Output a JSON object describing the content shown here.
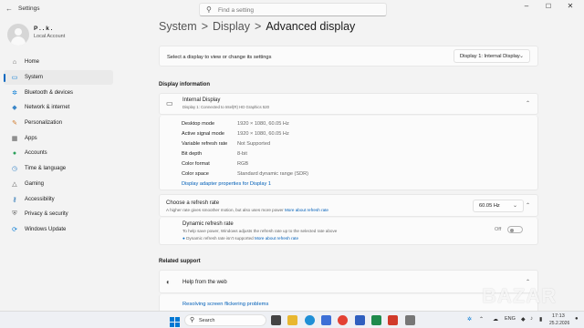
{
  "window": {
    "title": "Settings",
    "search_placeholder": "Find a setting"
  },
  "account": {
    "name": "P . . k .",
    "type": "Local Account"
  },
  "sidebar": {
    "items": [
      {
        "label": "Home",
        "icon": "home-icon"
      },
      {
        "label": "System",
        "icon": "system-icon",
        "active": true
      },
      {
        "label": "Bluetooth & devices",
        "icon": "bluetooth-icon"
      },
      {
        "label": "Network & internet",
        "icon": "wifi-icon"
      },
      {
        "label": "Personalization",
        "icon": "brush-icon"
      },
      {
        "label": "Apps",
        "icon": "apps-icon"
      },
      {
        "label": "Accounts",
        "icon": "person-icon"
      },
      {
        "label": "Time & language",
        "icon": "clock-icon"
      },
      {
        "label": "Gaming",
        "icon": "gamepad-icon"
      },
      {
        "label": "Accessibility",
        "icon": "accessibility-icon"
      },
      {
        "label": "Privacy & security",
        "icon": "shield-icon"
      },
      {
        "label": "Windows Update",
        "icon": "update-icon"
      }
    ]
  },
  "breadcrumb": {
    "first": "System",
    "second": "Display",
    "current": "Advanced display",
    "separator": ">"
  },
  "display_select": {
    "label": "Select a display to view or change its settings",
    "value": "Display 1: Internal Display"
  },
  "display_info": {
    "heading": "Display information",
    "name": "Internal Display",
    "subtitle": "Display 1: Connected to Intel(R) HD Graphics 520",
    "rows": [
      {
        "label": "Desktop mode",
        "value": "1920 × 1080, 60.05 Hz"
      },
      {
        "label": "Active signal mode",
        "value": "1920 × 1080, 60.05 Hz"
      },
      {
        "label": "Variable refresh rate",
        "value": "Not Supported"
      },
      {
        "label": "Bit depth",
        "value": "8-bit"
      },
      {
        "label": "Color format",
        "value": "RGB"
      },
      {
        "label": "Color space",
        "value": "Standard dynamic range (SDR)"
      }
    ],
    "adapter_link": "Display adapter properties for Display 1"
  },
  "refresh": {
    "title": "Choose a refresh rate",
    "desc": "A higher rate gives smoother motion, but also uses more power",
    "more_link": "More about refresh rate",
    "value": "60.05 Hz"
  },
  "dynamic_refresh": {
    "title": "Dynamic refresh rate",
    "desc": "To help save power, Windows adjusts the refresh rate up to the selected rate above",
    "status": "Dynamic refresh rate isn't supported",
    "more_link": "More about refresh rate",
    "toggle_label": "Off",
    "toggle_on": false
  },
  "related_support": {
    "heading": "Related support",
    "help_title": "Help from the web",
    "link1": "Resolving screen flickering problems"
  },
  "taskbar": {
    "search_label": "Search",
    "lang": "ENG",
    "time": "17:13",
    "date": "25.2.2026"
  },
  "watermark": "BAZAR",
  "colors": {
    "accent": "#0067c0",
    "link": "#005fb8",
    "background": "#f3f3f3"
  }
}
